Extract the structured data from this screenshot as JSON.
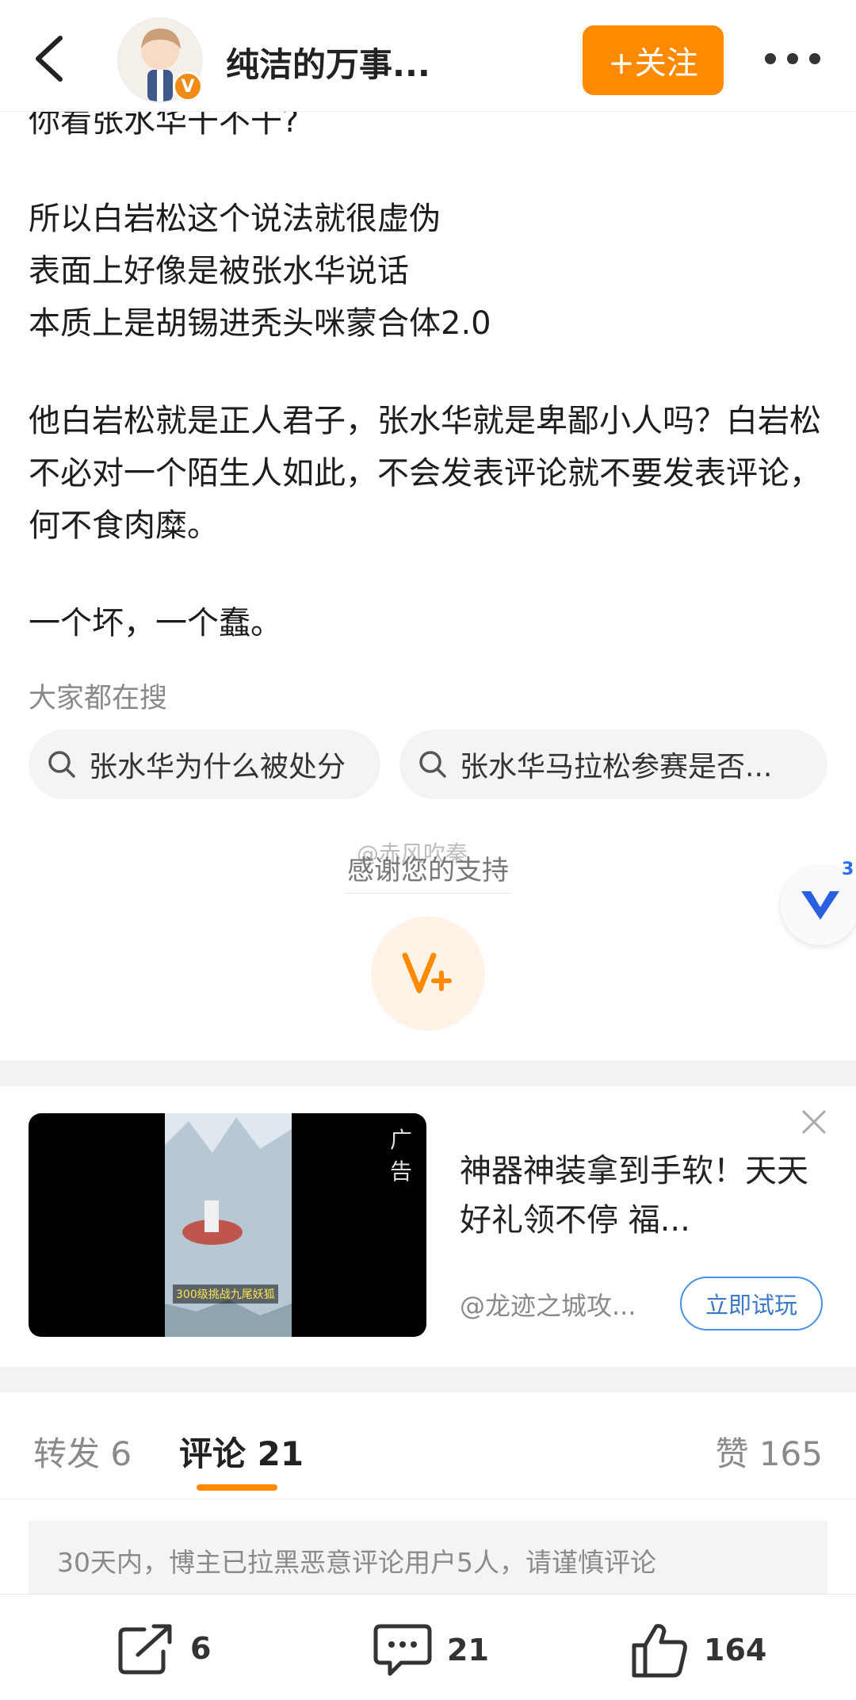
{
  "header": {
    "username": "纯洁的万事...",
    "follow_label": "+关注",
    "verified_badge": "V"
  },
  "post": {
    "lines": [
      "你看张水华干不干?",
      "",
      "所以白岩松这个说法就很虚伪",
      "表面上好像是被张水华说话",
      "本质上是胡锡进秃头咪蒙合体2.0",
      "",
      "他白岩松就是正人君子，张水华就是卑鄙小人吗？白岩松不必对一个陌生人如此，不会发表评论就不要发表评论，何不食肉糜。",
      "",
      "一个坏，一个蠢。"
    ]
  },
  "search": {
    "label": "大家都在搜",
    "chips": [
      "张水华为什么被处分",
      "张水华马拉松参赛是否..."
    ]
  },
  "support": {
    "thanks": "感谢您的支持",
    "watermark": "@赤风吹秦",
    "float_count": "3"
  },
  "ad": {
    "tag": "广告",
    "title": "神器神装拿到手软！天天好礼领不停 福...",
    "source": "@龙迹之城攻...",
    "button": "立即试玩",
    "image_caption": "300级挑战九尾妖狐"
  },
  "tabs": {
    "repost": "转发 6",
    "comment": "评论 21",
    "like": "赞 165"
  },
  "notice": "30天内，博主已拉黑恶意评论用户5人，请谨慎评论",
  "bottom_bar": {
    "share_count": "6",
    "comment_count": "21",
    "like_count": "164"
  },
  "colors": {
    "accent": "#ff8a00",
    "link_blue": "#3a78c8"
  }
}
